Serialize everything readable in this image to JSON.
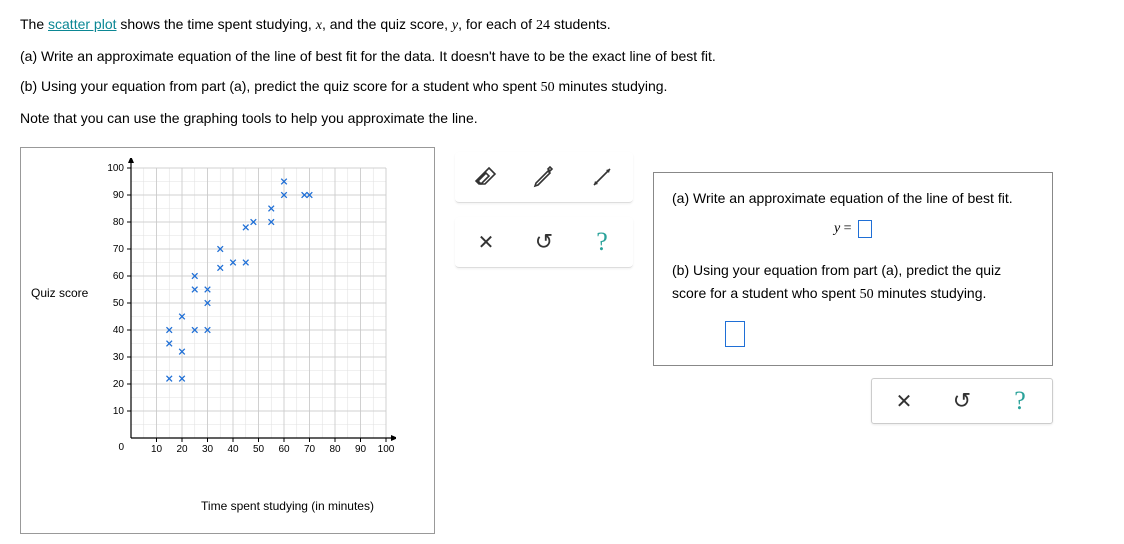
{
  "problem": {
    "intro_prefix": "The ",
    "link_term": "scatter plot",
    "intro_suffix_1": " shows the time spent studying, ",
    "var_x": "x",
    "intro_suffix_2": ", and the quiz score, ",
    "var_y": "y",
    "intro_suffix_3": ", for each of ",
    "n": "24",
    "intro_suffix_4": " students.",
    "part_a": "(a) Write an approximate equation of the line of best fit for the data. It doesn't have to be the exact line of best fit.",
    "part_b_prefix": "(b) Using your equation from part (a), predict the quiz score for a student who spent ",
    "part_b_minutes": "50",
    "part_b_suffix": " minutes studying.",
    "note": "Note that you can use the graphing tools to help you approximate the line."
  },
  "chart": {
    "y_label": "Quiz score",
    "x_label": "Time spent studying (in minutes)",
    "x_var": "x",
    "y_var": "y",
    "origin": "0"
  },
  "chart_data": {
    "type": "scatter",
    "title": "",
    "xlabel": "Time spent studying (in minutes)",
    "ylabel": "Quiz score",
    "xlim": [
      0,
      100
    ],
    "ylim": [
      0,
      100
    ],
    "x_ticks": [
      10,
      20,
      30,
      40,
      50,
      60,
      70,
      80,
      90,
      100
    ],
    "y_ticks": [
      10,
      20,
      30,
      40,
      50,
      60,
      70,
      80,
      90,
      100
    ],
    "points": [
      {
        "x": 15,
        "y": 22
      },
      {
        "x": 20,
        "y": 22
      },
      {
        "x": 15,
        "y": 35
      },
      {
        "x": 20,
        "y": 32
      },
      {
        "x": 15,
        "y": 40
      },
      {
        "x": 25,
        "y": 40
      },
      {
        "x": 30,
        "y": 40
      },
      {
        "x": 20,
        "y": 45
      },
      {
        "x": 30,
        "y": 50
      },
      {
        "x": 25,
        "y": 55
      },
      {
        "x": 30,
        "y": 55
      },
      {
        "x": 25,
        "y": 60
      },
      {
        "x": 35,
        "y": 63
      },
      {
        "x": 40,
        "y": 65
      },
      {
        "x": 35,
        "y": 70
      },
      {
        "x": 45,
        "y": 65
      },
      {
        "x": 45,
        "y": 78
      },
      {
        "x": 48,
        "y": 80
      },
      {
        "x": 55,
        "y": 80
      },
      {
        "x": 55,
        "y": 85
      },
      {
        "x": 60,
        "y": 90
      },
      {
        "x": 68,
        "y": 90
      },
      {
        "x": 70,
        "y": 90
      },
      {
        "x": 60,
        "y": 95
      }
    ]
  },
  "tools": {
    "eraser": "eraser-icon",
    "pencil": "pencil-icon",
    "line": "line-icon",
    "clear": "✕",
    "undo": "↺",
    "help": "?"
  },
  "answers": {
    "a_text": "(a) Write an approximate equation of the line of best fit.",
    "a_prefix_var": "y",
    "a_equals": " = ",
    "b_text_1": "(b) Using your equation from part (a), predict the quiz score for a student who spent ",
    "b_minutes": "50",
    "b_text_2": " minutes studying."
  },
  "actions": {
    "clear": "✕",
    "undo": "↺",
    "help": "?"
  }
}
